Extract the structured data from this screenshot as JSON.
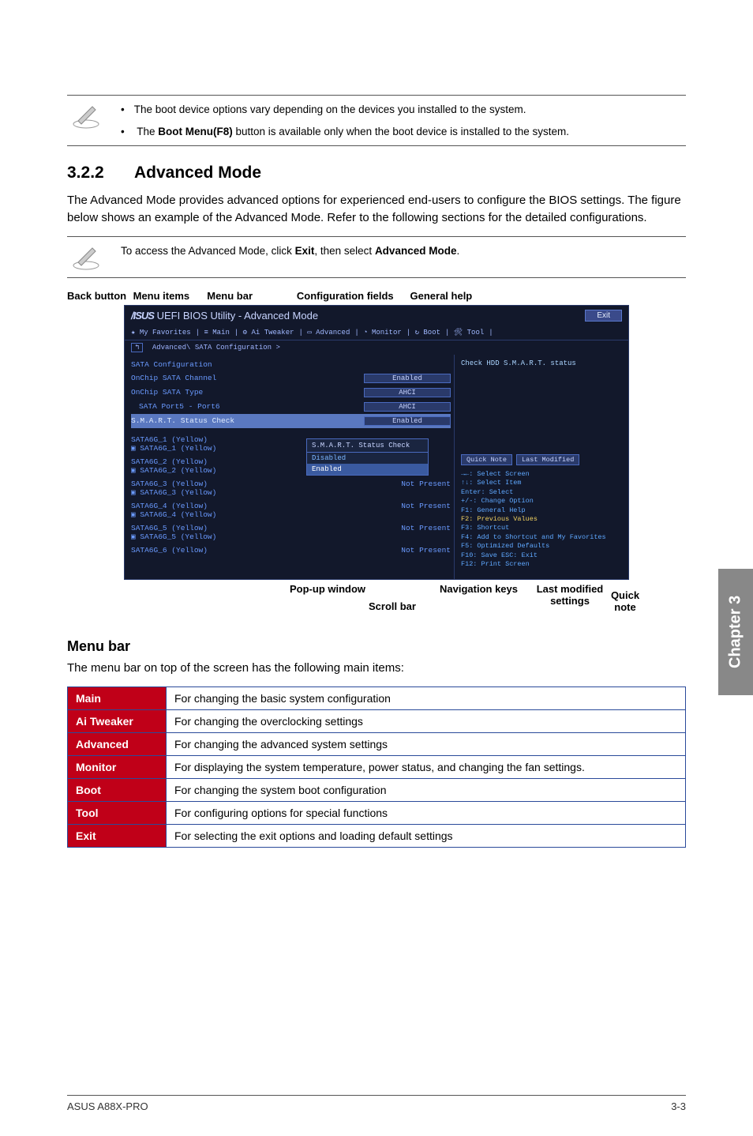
{
  "notes": {
    "note1_item1": "The boot device options vary depending on the devices you installed to the system.",
    "note1_item2_pre": "The ",
    "note1_item2_bold": "Boot Menu(F8)",
    "note1_item2_post": " button is available only when the boot device is installed to the system.",
    "note2_pre": "To access the Advanced Mode, click ",
    "note2_b1": "Exit",
    "note2_mid": ", then select ",
    "note2_b2": "Advanced Mode",
    "note2_post": "."
  },
  "section": {
    "num": "3.2.2",
    "title": "Advanced Mode",
    "body": "The Advanced Mode provides advanced options for experienced end-users to configure the BIOS settings. The figure below shows an example of the Advanced Mode. Refer to the following sections for the detailed configurations."
  },
  "labels_top": {
    "back": "Back button",
    "menu_items": "Menu items",
    "menu_bar": "Menu bar",
    "config_fields": "Configuration fields",
    "general_help": "General help"
  },
  "bios": {
    "logo": "/ISUS",
    "title": "UEFI BIOS Utility - Advanced Mode",
    "exit": "Exit",
    "nav": [
      "★ My Favorites",
      "≡ Main",
      "⚙ Ai Tweaker",
      "▭ Advanced",
      "◔ Monitor",
      "↻ Boot",
      "🛠 Tool"
    ],
    "breadcrumb_back": "↰",
    "breadcrumb": "Advanced\\ SATA Configuration >",
    "rows": [
      {
        "label": "SATA Configuration",
        "value": ""
      },
      {
        "label": "OnChip SATA Channel",
        "value": "Enabled"
      },
      {
        "label": "OnChip SATA Type",
        "value": "AHCI"
      },
      {
        "label": "SATA Port5 - Port6",
        "value": "AHCI"
      },
      {
        "label": "S.M.A.R.T. Status Check",
        "value": "Enabled",
        "hl": true
      },
      {
        "label": "SATA6G_1 (Yellow)",
        "sub": "▣ SATA6G_1 (Yellow)",
        "value": ""
      },
      {
        "label": "SATA6G_2 (Yellow)",
        "sub": "▣ SATA6G_2 (Yellow)",
        "value": ""
      },
      {
        "label": "SATA6G_3 (Yellow)",
        "sub": "▣ SATA6G_3 (Yellow)",
        "value": "Not Present"
      },
      {
        "label": "SATA6G_4 (Yellow)",
        "sub": "▣ SATA6G_4 (Yellow)",
        "value": "Not Present"
      },
      {
        "label": "SATA6G_5 (Yellow)",
        "sub": "▣ SATA6G_5 (Yellow)",
        "value": "Not Present"
      },
      {
        "label": "SATA6G_6 (Yellow)",
        "sub": "",
        "value": "Not Present"
      }
    ],
    "popup_title": "S.M.A.R.T. Status Check",
    "popup_items": [
      "Disabled",
      "Enabled"
    ],
    "help": "Check HDD S.M.A.R.T. status",
    "quick_note": "Quick Note",
    "last_mod": "Last Modified",
    "navkeys": [
      "→←: Select Screen",
      "↑↓: Select Item",
      "Enter: Select",
      "+/-: Change Option",
      "F1: General Help",
      "F2: Previous Values",
      "F3: Shortcut",
      "F4: Add to Shortcut and My Favorites",
      "F5: Optimized Defaults",
      "F10: Save  ESC: Exit",
      "F12: Print Screen"
    ]
  },
  "labels_bottom": {
    "popup": "Pop-up window",
    "scroll": "Scroll bar",
    "nav": "Navigation keys",
    "last": "Last modified settings",
    "quick": "Quick note"
  },
  "menu_bar": {
    "title": "Menu bar",
    "intro": "The menu bar on top of the screen has the following main items:",
    "rows": [
      {
        "head": "Main",
        "desc": "For changing the basic system configuration"
      },
      {
        "head": "Ai Tweaker",
        "desc": "For changing the overclocking settings"
      },
      {
        "head": "Advanced",
        "desc": "For changing the advanced system settings"
      },
      {
        "head": "Monitor",
        "desc": "For displaying the system temperature, power status, and changing the fan settings."
      },
      {
        "head": "Boot",
        "desc": "For changing the system boot configuration"
      },
      {
        "head": "Tool",
        "desc": "For configuring options for special functions"
      },
      {
        "head": "Exit",
        "desc": "For selecting the exit options and loading default settings"
      }
    ]
  },
  "side_tab": "Chapter 3",
  "footer": {
    "left": "ASUS A88X-PRO",
    "right": "3-3"
  }
}
